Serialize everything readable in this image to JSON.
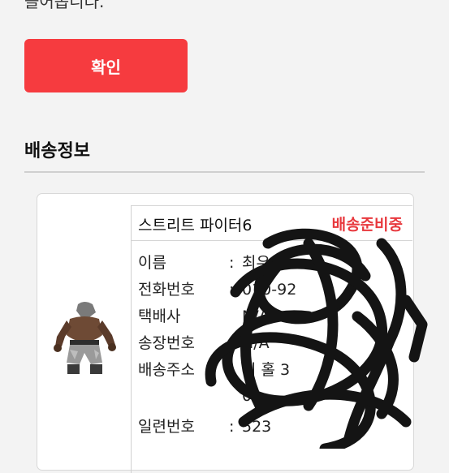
{
  "top_text": "들어옵니다.",
  "confirm_button": "확인",
  "section_title": "배송정보",
  "order": {
    "product_name": "스트리트 파이터6",
    "status": "배송준비중",
    "fields": [
      {
        "label": "이름",
        "sep": ":",
        "value": "최우"
      },
      {
        "label": "전화번호",
        "sep": ":",
        "value": "010-92"
      },
      {
        "label": "택배사",
        "sep": "",
        "value": "N/A"
      },
      {
        "label": "송장번호",
        "sep": "",
        "value": "N/A"
      },
      {
        "label": "배송주소",
        "sep": "",
        "value": "시 홀    3"
      },
      {
        "label": "",
        "sep": "",
        "value": "0"
      },
      {
        "label": "일련번호",
        "sep": ":",
        "value": "523"
      }
    ]
  },
  "colors": {
    "accent": "#f63b3f",
    "status": "#e8383d"
  }
}
